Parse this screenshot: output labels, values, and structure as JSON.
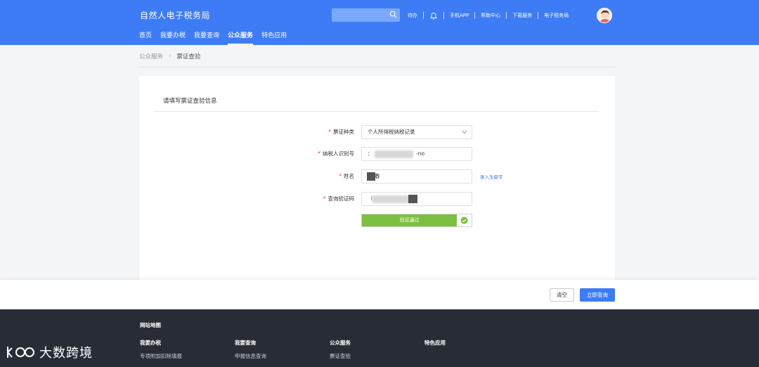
{
  "header": {
    "title": "自然人电子税务局",
    "links": [
      "待办",
      "手机APP",
      "帮助中心",
      "下载服务",
      "电子税务局"
    ],
    "nav": [
      "首页",
      "我要办税",
      "我要查询",
      "公众服务",
      "特色应用"
    ],
    "active_nav": "公众服务"
  },
  "breadcrumb": {
    "parent": "公众服务",
    "current": "票证查验"
  },
  "card": {
    "title": "请填写票证查验信息"
  },
  "form": {
    "ticket_type": {
      "label": "票证种类",
      "value": "个人所得税纳税记录"
    },
    "taxpayer_id": {
      "label": "纳税人识别号",
      "value_prefix": "：",
      "value_suffix": "-no"
    },
    "name": {
      "label": "姓名",
      "value": "春",
      "link": "录入生僻字"
    },
    "verify_code": {
      "label": "查询验证码",
      "value_prefix": "（"
    }
  },
  "slider": {
    "text": "验证通过"
  },
  "actions": {
    "clear": "清空",
    "query": "立即查询"
  },
  "footer": {
    "sitemap": "网站地图",
    "columns": [
      {
        "heading": "我要办税",
        "item": "专项附加扣除填报"
      },
      {
        "heading": "我要查询",
        "item": "申报信息查询"
      },
      {
        "heading": "公众服务",
        "item": "票证查验"
      },
      {
        "heading": "特色应用",
        "item": ""
      }
    ]
  },
  "watermark": {
    "text": "大数跨境"
  },
  "colors": {
    "brand": "#3d7cf4",
    "success": "#7dbf3f",
    "footer_bg": "#272c35"
  }
}
